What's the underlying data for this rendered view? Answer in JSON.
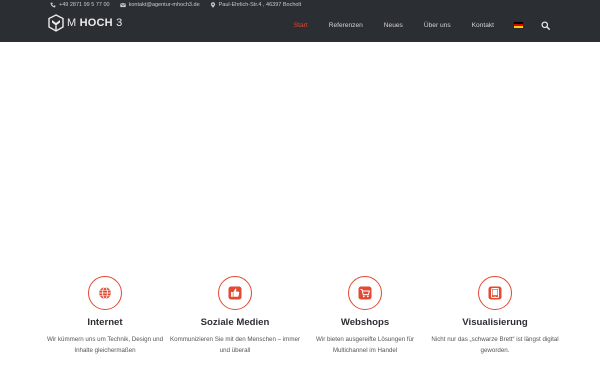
{
  "topbar": {
    "phone": "+49 2871 99 5 77 00",
    "email": "kontakt@agentur-mhoch3.de",
    "address": "Paul-Ehrlich-Str.4 , 46397 Bocholt"
  },
  "logo": {
    "prefix": "M",
    "bold": "HOCH",
    "suffix": "3"
  },
  "nav": {
    "items": [
      "Start",
      "Referenzen",
      "Neues",
      "Über uns",
      "Kontakt"
    ],
    "active": "Start"
  },
  "colors": {
    "accent": "#e24a33",
    "header_bg": "#2b2e33"
  },
  "icons": {
    "phone": "phone-icon",
    "email": "envelope-icon",
    "address": "map-marker-icon",
    "language": "german-flag-icon",
    "search": "search-icon"
  },
  "features": [
    {
      "title": "Internet",
      "icon": "globe-icon",
      "text": "Wir kümmern uns um Technik, Design und Inhalte gleichermaßen"
    },
    {
      "title": "Soziale Medien",
      "icon": "thumbs-up-icon",
      "text": "Kommunizieren Sie mit den Menschen – immer und überall"
    },
    {
      "title": "Webshops",
      "icon": "shopping-cart-icon",
      "text": "Wir bieten ausgereifte Lösungen für Multichannel im Handel"
    },
    {
      "title": "Visualisierung",
      "icon": "tablet-icon",
      "text": "Nicht nur das „schwarze Brett“ ist längst digital geworden."
    }
  ]
}
